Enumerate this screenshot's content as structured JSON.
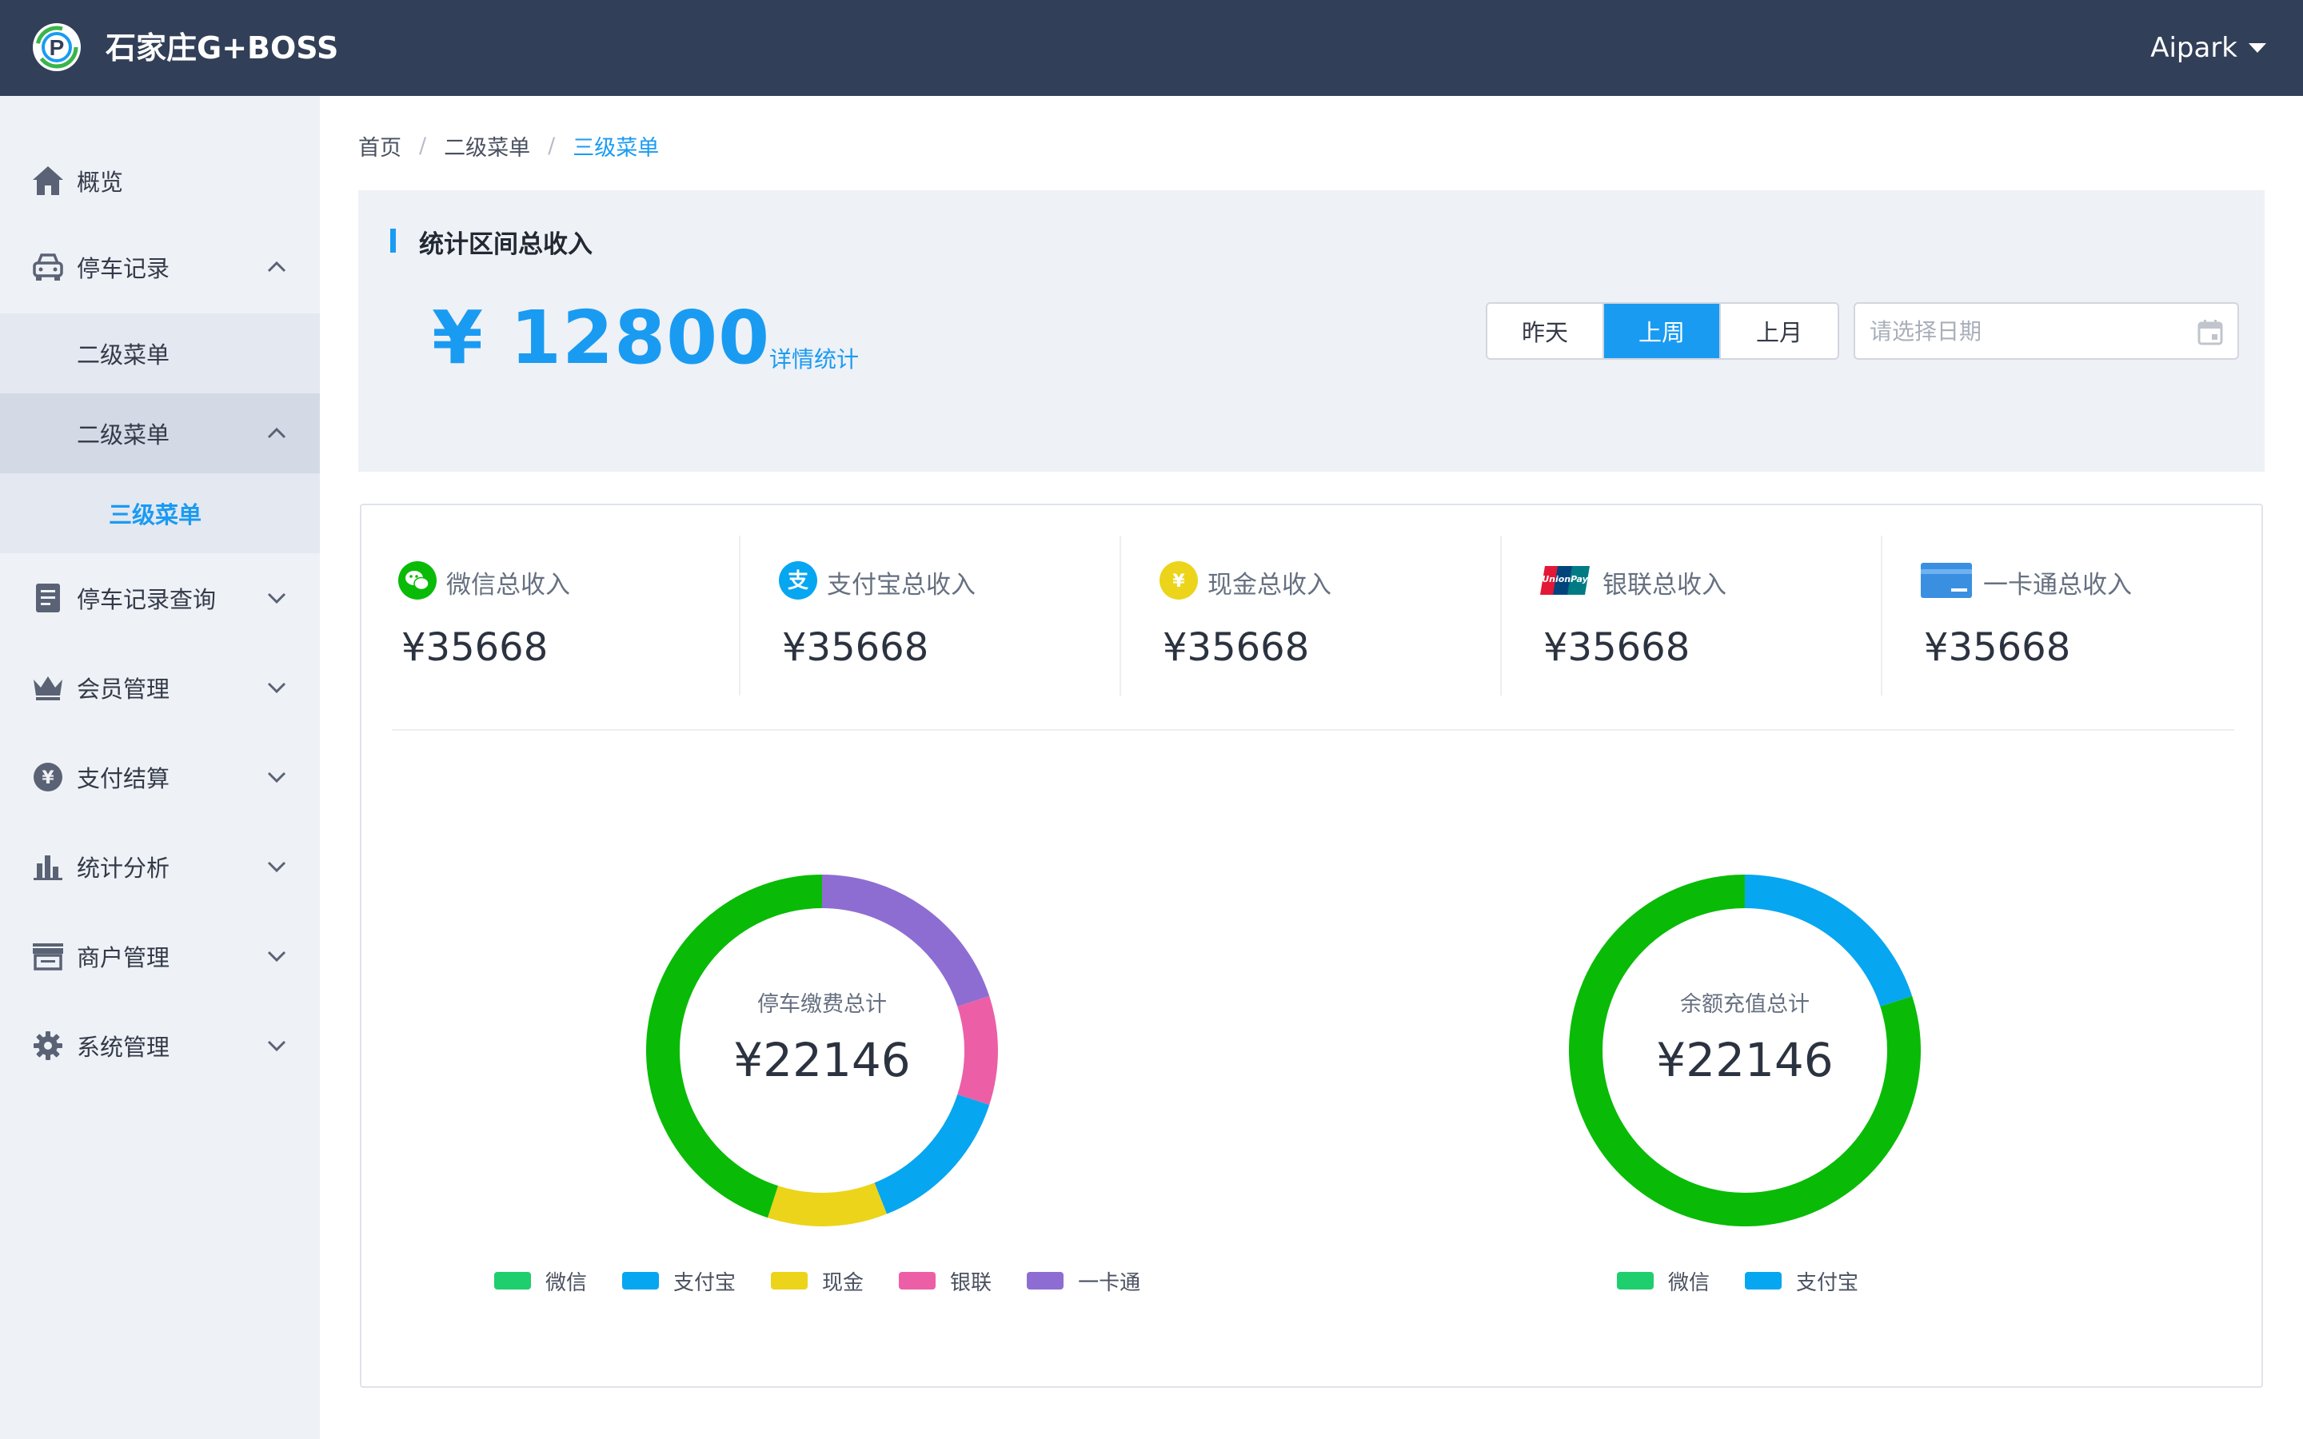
{
  "header": {
    "brand": "石家庄G+BOSS",
    "user": "Aipark"
  },
  "sidebar": {
    "items": [
      {
        "label": "概览",
        "icon": "home-icon"
      },
      {
        "label": "停车记录",
        "icon": "car-icon",
        "expanded": true
      },
      {
        "label": "停车记录查询",
        "icon": "document-icon"
      },
      {
        "label": "会员管理",
        "icon": "crown-icon"
      },
      {
        "label": "支付结算",
        "icon": "yen-icon"
      },
      {
        "label": "统计分析",
        "icon": "bar-chart-icon"
      },
      {
        "label": "商户管理",
        "icon": "store-icon"
      },
      {
        "label": "系统管理",
        "icon": "gear-icon"
      }
    ],
    "sub_items": [
      "二级菜单",
      "二级菜单"
    ],
    "third_item": "三级菜单"
  },
  "breadcrumb": [
    "首页",
    "二级菜单",
    "三级菜单"
  ],
  "summary": {
    "title": "统计区间总收入",
    "amount": "¥ 12800",
    "detail_link": "详情统计",
    "ranges": [
      "昨天",
      "上周",
      "上月"
    ],
    "active_range": "上周",
    "date_placeholder": "请选择日期"
  },
  "stats": [
    {
      "label": "微信总收入",
      "value": "¥35668",
      "icon": "wechat-icon"
    },
    {
      "label": "支付宝总收入",
      "value": "¥35668",
      "icon": "alipay-icon"
    },
    {
      "label": "现金总收入",
      "value": "¥35668",
      "icon": "cash-icon"
    },
    {
      "label": "银联总收入",
      "value": "¥35668",
      "icon": "unionpay-icon"
    },
    {
      "label": "一卡通总收入",
      "value": "¥35668",
      "icon": "card-icon"
    }
  ],
  "colors": {
    "accent": "#1a9bf2",
    "header_bg": "#323f58",
    "wechat": "#09bb07",
    "alipay": "#07a6f0",
    "cash": "#ecd41a",
    "unionpay": "#ec5fa6",
    "card": "#8e6dd3"
  },
  "chart_data": [
    {
      "type": "pie",
      "title": "停车缴费总计",
      "center_value": "¥22146",
      "categories": [
        "微信",
        "支付宝",
        "现金",
        "银联",
        "一卡通"
      ],
      "values": [
        45,
        14,
        11,
        10,
        20
      ],
      "colors": [
        "#09bb07",
        "#07a6f0",
        "#ecd41a",
        "#ec5fa6",
        "#8e6dd3"
      ],
      "legend": [
        "微信",
        "支付宝",
        "现金",
        "银联",
        "一卡通"
      ],
      "legend_colors": [
        "#1fce6d",
        "#07a6f0",
        "#ecd41a",
        "#ec5fa6",
        "#8e6dd3"
      ]
    },
    {
      "type": "pie",
      "title": "余额充值总计",
      "center_value": "¥22146",
      "categories": [
        "微信",
        "支付宝"
      ],
      "values": [
        80,
        20
      ],
      "colors": [
        "#09bb07",
        "#07a6f0"
      ],
      "legend": [
        "微信",
        "支付宝"
      ],
      "legend_colors": [
        "#1fce6d",
        "#07a6f0"
      ]
    }
  ]
}
